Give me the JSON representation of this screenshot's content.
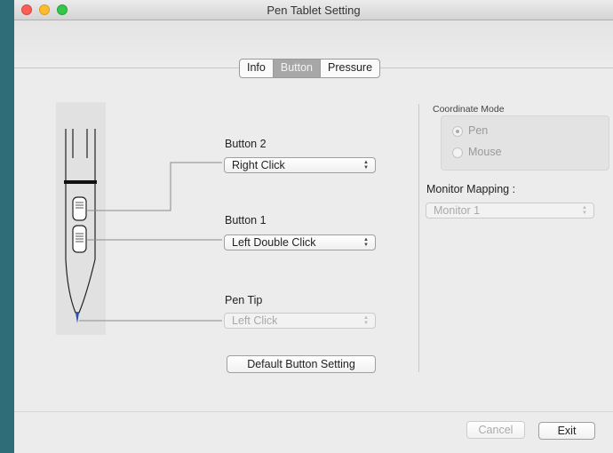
{
  "window": {
    "title": "Pen Tablet Setting"
  },
  "tabs": [
    {
      "label": "Info",
      "active": false
    },
    {
      "label": "Button",
      "active": true
    },
    {
      "label": "Pressure",
      "active": false
    }
  ],
  "buttons": {
    "button2": {
      "label": "Button 2",
      "value": "Right Click"
    },
    "button1": {
      "label": "Button 1",
      "value": "Left Double Click"
    },
    "pentip": {
      "label": "Pen Tip",
      "value": "Left Click",
      "disabled": true
    },
    "default_button_label": "Default Button Setting"
  },
  "coordinate": {
    "title": "Coordinate Mode",
    "options": [
      {
        "label": "Pen",
        "checked": true
      },
      {
        "label": "Mouse",
        "checked": false
      }
    ]
  },
  "monitor": {
    "label": "Monitor Mapping :",
    "value": "Monitor 1"
  },
  "footer": {
    "cancel_label": "Cancel",
    "exit_label": "Exit"
  },
  "colors": {
    "desktop": "#2f6e78",
    "pen_tip": "#2f4fa8"
  }
}
